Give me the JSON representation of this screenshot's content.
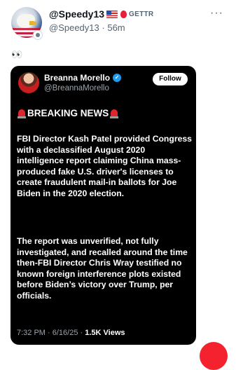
{
  "post": {
    "author_name": "@Speedy13",
    "platform_label": "GETTR",
    "handle": "@Speedy13",
    "separator": "·",
    "time_ago": "56m",
    "more_label": "···",
    "text": "👀"
  },
  "quoted": {
    "author_name": "Breanna Morello",
    "handle": "@BreannaMorello",
    "follow_label": "Follow",
    "headline": "BREAKING NEWS",
    "paragraph1": "FBI Director Kash Patel provided Congress with a declassified August 2020 intelligence report claiming China mass-produced fake U.S. driver's licenses to create fraudulent mail-in ballots for Joe Biden in the 2020 election.",
    "paragraph2": "The report was unverified, not fully investigated, and recalled around the time then-FBI Director Chris Wray testified no known foreign interference plots existed before Biden’s victory over Trump, per officials.",
    "meta_time": "7:32 PM · 6/16/25 ·",
    "meta_views": "1.5K Views"
  },
  "colors": {
    "accent_red": "#f4212e",
    "verified_blue": "#1d9bf0",
    "card_bg": "#000000"
  },
  "icons": [
    "avatar-eagle",
    "us-flag-icon",
    "gettr-logo-icon",
    "verified-badge-icon",
    "siren-icon",
    "more-dots-icon"
  ]
}
